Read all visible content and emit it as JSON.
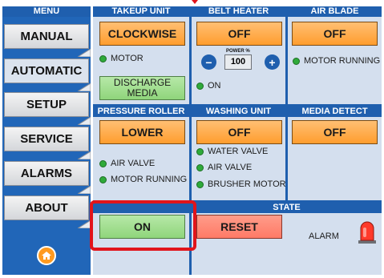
{
  "sidebar": {
    "header": "MENU",
    "items": [
      {
        "label": "MANUAL",
        "active": false
      },
      {
        "label": "AUTOMATIC",
        "active": true
      },
      {
        "label": "SETUP",
        "active": false
      },
      {
        "label": "SERVICE",
        "active": false
      },
      {
        "label": "ALARMS",
        "active": false
      },
      {
        "label": "ABOUT",
        "active": false
      }
    ],
    "home_icon": "home-icon"
  },
  "takeup_unit": {
    "title": "TAKEUP UNIT",
    "button": "CLOCKWISE",
    "indicator": "MOTOR",
    "discharge_button": "DISCHARGE\nMEDIA"
  },
  "belt_heater": {
    "title": "BELT HEATER",
    "button": "OFF",
    "power_label": "POWER %",
    "power_value": "100",
    "minus": "−",
    "plus": "+",
    "indicator": "ON"
  },
  "air_blade": {
    "title": "AIR BLADE",
    "button": "OFF",
    "indicator": "MOTOR RUNNING"
  },
  "pressure_roller": {
    "title": "PRESSURE ROLLER",
    "button": "LOWER",
    "indicators": [
      "AIR VALVE",
      "MOTOR RUNNING"
    ]
  },
  "washing_unit": {
    "title": "WASHING UNIT",
    "button": "OFF",
    "indicators": [
      "WATER VALVE",
      "AIR VALVE",
      "BRUSHER MOTOR"
    ]
  },
  "media_detect": {
    "title": "MEDIA DETECT",
    "button": "OFF"
  },
  "centering_unit": {
    "button": "ON"
  },
  "state": {
    "title": "STATE",
    "reset_button": "RESET",
    "alarm_label": "ALARM"
  },
  "colors": {
    "header_blue": "#1f5fae",
    "panel_bg": "#d4dfee",
    "orange_button": "#ff9d2e",
    "green_button": "#8fd57b",
    "red_button": "#ff7a66",
    "indicator_green": "#2faa3a",
    "highlight_red": "#e1141b"
  }
}
